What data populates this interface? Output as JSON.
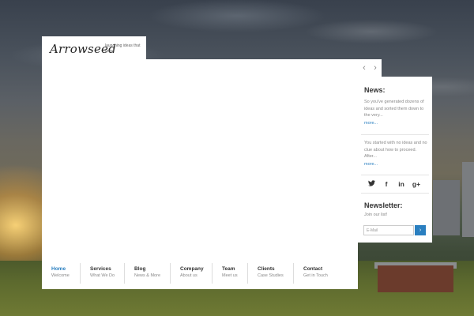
{
  "brand": {
    "logo": "Arrowseed",
    "tagline": "launching ideas that grow."
  },
  "slider": {
    "prev_icon": "‹",
    "next_icon": "›"
  },
  "nav": {
    "items": [
      {
        "label": "Home",
        "sub": "Welcome"
      },
      {
        "label": "Services",
        "sub": "What We Do"
      },
      {
        "label": "Blog",
        "sub": "News & More"
      },
      {
        "label": "Company",
        "sub": "About us"
      },
      {
        "label": "Team",
        "sub": "Meet us"
      },
      {
        "label": "Clients",
        "sub": "Case Studies"
      },
      {
        "label": "Contact",
        "sub": "Get in Touch"
      }
    ]
  },
  "sidebar": {
    "news_title": "News:",
    "news": [
      {
        "text": "So you've generated dozens of ideas and sorted them down to the very...",
        "more": "more..."
      },
      {
        "text": "You started with no ideas and no clue about how to proceed. After...",
        "more": "more..."
      }
    ],
    "social": {
      "twitter": "🐦",
      "facebook": "f",
      "linkedin": "in",
      "googleplus": "g+"
    },
    "newsletter_title": "Newsletter:",
    "newsletter_sub": "Join our list!",
    "email_placeholder": "E-Mail",
    "submit_icon": "›"
  },
  "colors": {
    "accent": "#2a7fc0"
  }
}
